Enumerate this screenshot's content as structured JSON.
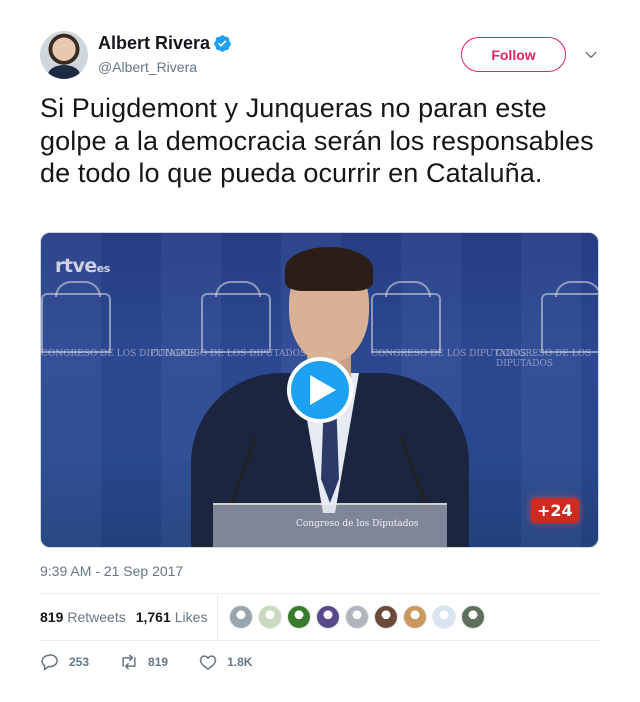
{
  "author": {
    "name": "Albert Rivera",
    "handle": "@Albert_Rivera",
    "verified": true
  },
  "header": {
    "follow_label": "Follow"
  },
  "tweet": {
    "text": "Si Puigdemont y Junqueras no paran este golpe a la democracia serán los responsables de todo lo que pueda ocurrir en Cataluña.",
    "timestamp": "9:39 AM - 21 Sep 2017"
  },
  "media": {
    "type": "video",
    "overlay_logo": "rtve",
    "overlay_logo_suffix": "es",
    "badge": "+24",
    "crest_caption": "CONGRESO DE LOS DIPUTADOS",
    "podium_caption": "Congreso de los Diputados"
  },
  "stats": {
    "retweets_count": "819",
    "retweets_label": "Retweets",
    "likes_count": "1,761",
    "likes_label": "Likes",
    "liker_avatars": [
      "#9aa4ad",
      "#c8d9c0",
      "#3a7a2c",
      "#5a4a8a",
      "#b0b6bc",
      "#6c4a3a",
      "#c9985f",
      "#d8e4ef",
      "#5f6f5c"
    ]
  },
  "actions": {
    "replies": "253",
    "retweets": "819",
    "likes": "1.8K"
  },
  "colors": {
    "accent": "#1da1f2",
    "follow": "#e0245e",
    "muted": "#657786"
  }
}
